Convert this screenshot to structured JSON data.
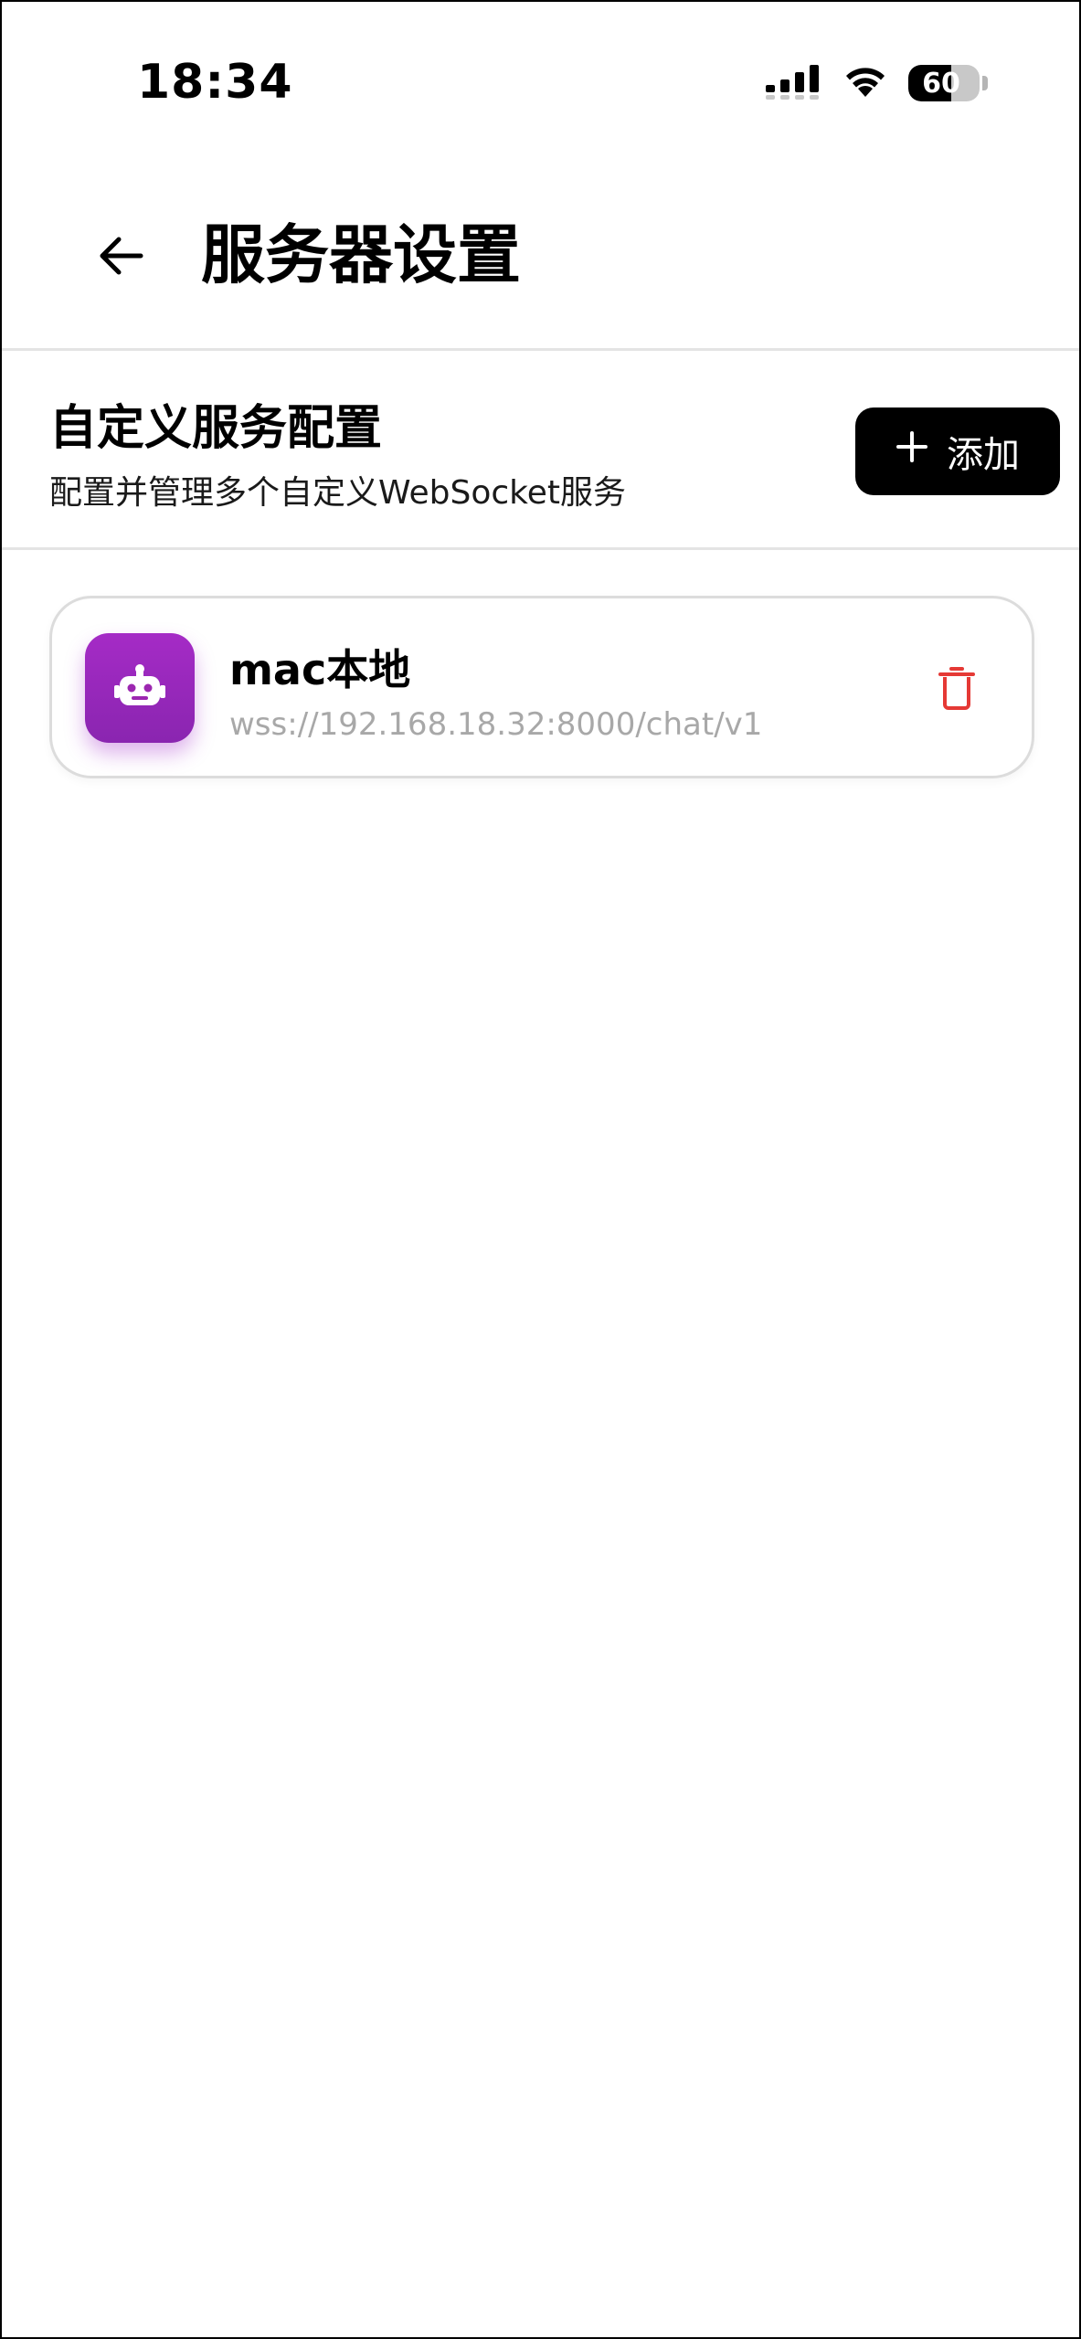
{
  "status_bar": {
    "time": "18:34",
    "battery_level": "60",
    "battery_fraction": 0.6,
    "icons": [
      "signal-icon",
      "wifi-icon",
      "battery-icon"
    ]
  },
  "app_bar": {
    "back_icon": "back-arrow-icon",
    "title": "服务器设置"
  },
  "section": {
    "title": "自定义服务配置",
    "subtitle": "配置并管理多个自定义WebSocket服务",
    "add_button_label": "添加",
    "add_button_icon": "plus-icon"
  },
  "servers": [
    {
      "name": "mac本地",
      "url": "wss://192.168.18.32:8000/chat/v1",
      "icon": "robot-icon",
      "icon_color": "#9c27b0",
      "delete_icon": "trash-icon",
      "delete_color": "#e53935"
    }
  ]
}
